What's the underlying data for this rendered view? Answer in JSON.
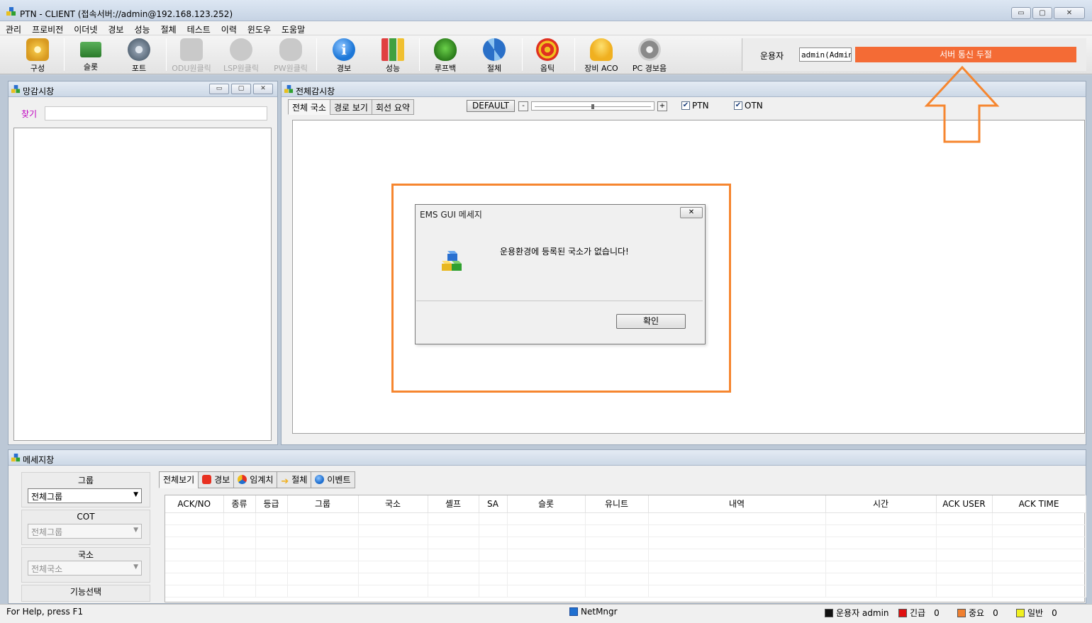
{
  "window": {
    "title": "PTN - CLIENT (접속서버://admin@192.168.123.252)",
    "controls": {
      "minimize": "▭",
      "maximize": "▢",
      "close": "✕"
    }
  },
  "menu": [
    "관리",
    "프로비전",
    "이더넷",
    "경보",
    "성능",
    "절체",
    "테스트",
    "이력",
    "윈도우",
    "도움말"
  ],
  "toolbar": {
    "buttons": [
      {
        "label": "구성",
        "icon": "config-gear-icon",
        "color": "#f0c040",
        "enabled": true
      },
      {
        "label": "슬롯",
        "icon": "slot-card-icon",
        "color": "#3a8a3a",
        "enabled": true
      },
      {
        "label": "포트",
        "icon": "port-gear-icon",
        "color": "#7a8a9a",
        "enabled": true
      },
      {
        "label": "ODU원클릭",
        "icon": "odu-oneclick-icon",
        "color": "#c4c4c4",
        "enabled": false
      },
      {
        "label": "LSP원클릭",
        "icon": "lsp-oneclick-icon",
        "color": "#c4c4c4",
        "enabled": false
      },
      {
        "label": "PW원클릭",
        "icon": "pw-oneclick-icon",
        "color": "#c4c4c4",
        "enabled": false
      },
      {
        "label": "경보",
        "icon": "info-alarm-icon",
        "color": "#1e78d8",
        "enabled": true
      },
      {
        "label": "성능",
        "icon": "performance-chart-icon",
        "color": "#4aa34a",
        "enabled": true
      },
      {
        "label": "루프백",
        "icon": "loopback-bug-icon",
        "color": "#3a9a2a",
        "enabled": true
      },
      {
        "label": "절체",
        "icon": "switchover-arrows-icon",
        "color": "#2a70c8",
        "enabled": true
      },
      {
        "label": "옵틱",
        "icon": "optic-target-icon",
        "color": "#e03020",
        "enabled": true
      },
      {
        "label": "장비 ACO",
        "icon": "aco-bell-icon",
        "color": "#f0b020",
        "enabled": true
      },
      {
        "label": "PC 경보음",
        "icon": "speaker-icon",
        "color": "#8a8a8a",
        "enabled": true
      }
    ],
    "operator_label": "운용자",
    "operator_value": "admin(Admin)",
    "server_status": "서버 통신 두절",
    "server_status_color": "#f46b35"
  },
  "net_window": {
    "title": "망감시창",
    "search_label": "찾기",
    "search_value": ""
  },
  "main_window": {
    "title": "전체감시창",
    "tabs": [
      "전체 국소",
      "경로 보기",
      "회선 요약"
    ],
    "default_button": "DEFAULT",
    "zoom_minus": "-",
    "zoom_plus": "+",
    "checkboxes": [
      {
        "label": "PTN",
        "checked": true
      },
      {
        "label": "OTN",
        "checked": true
      }
    ]
  },
  "dialog": {
    "title": "EMS GUI 메세지",
    "message": "운용환경에 등록된 국소가 없습니다!",
    "ok_label": "확인",
    "close_label": "✕"
  },
  "message_window": {
    "title": "메세지창",
    "group_label": "그룹",
    "group_value": "전체그룹",
    "cot_label": "COT",
    "cot_value": "전체그룹",
    "station_label": "국소",
    "station_value": "전체국소",
    "function_label": "기능선택",
    "tabs": [
      {
        "label": "전체보기",
        "color": ""
      },
      {
        "label": "경보",
        "color": "#e83020"
      },
      {
        "label": "임계치",
        "color": "#f0a020"
      },
      {
        "label": "절체",
        "color": "#f0c020"
      },
      {
        "label": "이벤트",
        "color": "#2070d0"
      }
    ],
    "columns": [
      "ACK/NO",
      "종류",
      "등급",
      "그룹",
      "국소",
      "셸프",
      "SA",
      "슬롯",
      "유니트",
      "내역",
      "시간",
      "ACK USER",
      "ACK TIME"
    ]
  },
  "status_bar": {
    "help": "For Help, press F1",
    "netmngr": "NetMngr",
    "operator": "운용자 admin",
    "urgent_label": "긴급",
    "urgent_count": "0",
    "major_label": "중요",
    "major_count": "0",
    "normal_label": "일반",
    "normal_count": "0",
    "urgent_color": "#e01010",
    "major_color": "#f08030",
    "normal_color": "#f0f020"
  },
  "annotation_color": "#f6862f"
}
